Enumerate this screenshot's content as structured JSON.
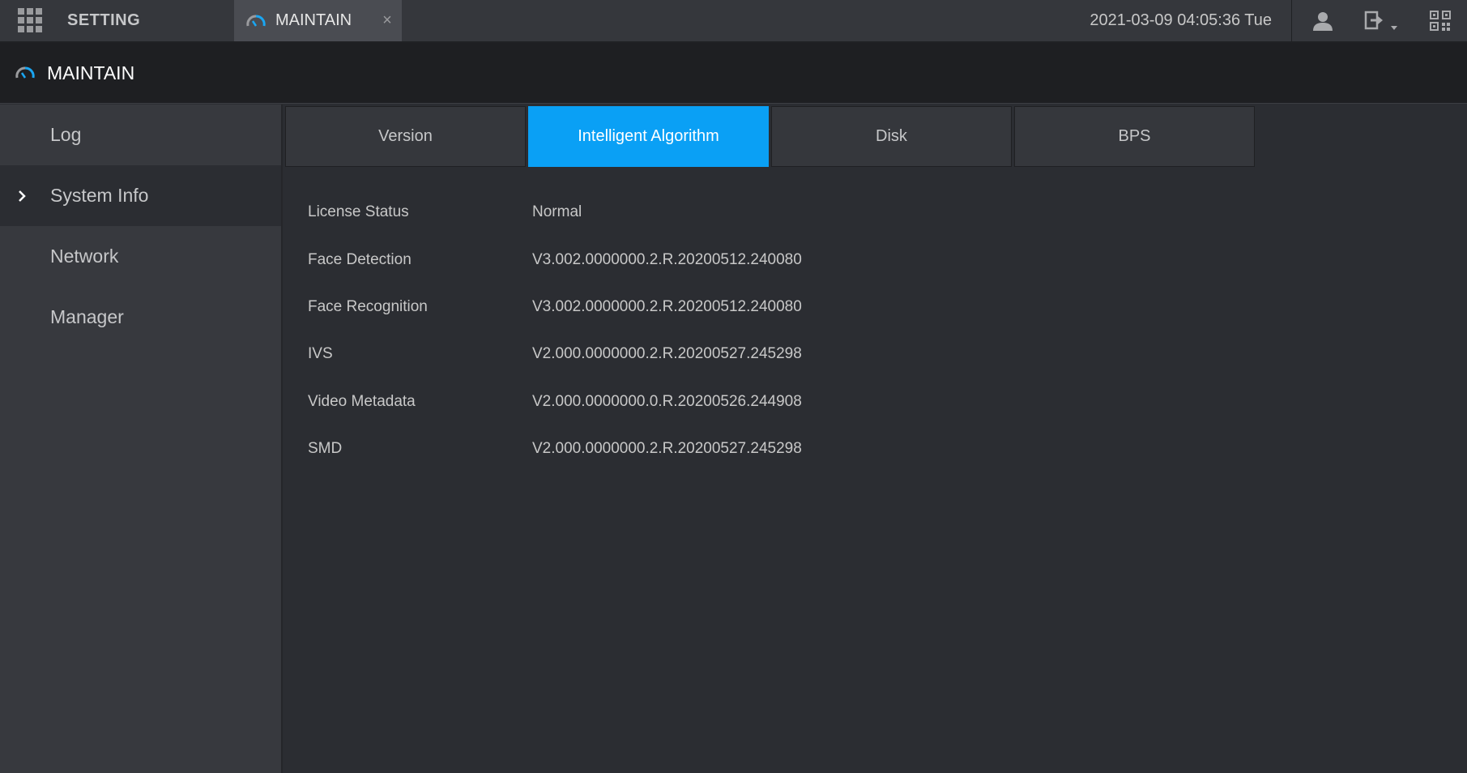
{
  "topbar": {
    "apps_icon": "grid-icon",
    "setting_label": "SETTING",
    "tab_title": "MAINTAIN",
    "tab_close": "×",
    "datetime": "2021-03-09 04:05:36 Tue",
    "icons": [
      "user-icon",
      "logout-icon",
      "qr-code-icon"
    ]
  },
  "header": {
    "title": "MAINTAIN",
    "icon": "gauge-icon"
  },
  "sidebar": {
    "items": [
      {
        "label": "Log"
      },
      {
        "label": "System Info"
      },
      {
        "label": "Network"
      },
      {
        "label": "Manager"
      }
    ],
    "active_index": 1
  },
  "tabs": {
    "items": [
      {
        "label": "Version"
      },
      {
        "label": "Intelligent Algorithm"
      },
      {
        "label": "Disk"
      },
      {
        "label": "BPS"
      }
    ],
    "active_index": 1
  },
  "info": {
    "rows": [
      {
        "key": "License Status",
        "value": "Normal"
      },
      {
        "key": "Face Detection",
        "value": "V3.002.0000000.2.R.20200512.240080"
      },
      {
        "key": "Face Recognition",
        "value": "V3.002.0000000.2.R.20200512.240080"
      },
      {
        "key": "IVS",
        "value": "V2.000.0000000.2.R.20200527.245298"
      },
      {
        "key": "Video Metadata",
        "value": "V2.000.0000000.0.R.20200526.244908"
      },
      {
        "key": "SMD",
        "value": "V2.000.0000000.2.R.20200527.245298"
      }
    ]
  },
  "colors": {
    "accent": "#0aa0f5",
    "topbar_bg": "#35373c",
    "header_bg": "#1e1f22",
    "sidebar_bg": "#37393e",
    "content_bg": "#2b2d32"
  }
}
